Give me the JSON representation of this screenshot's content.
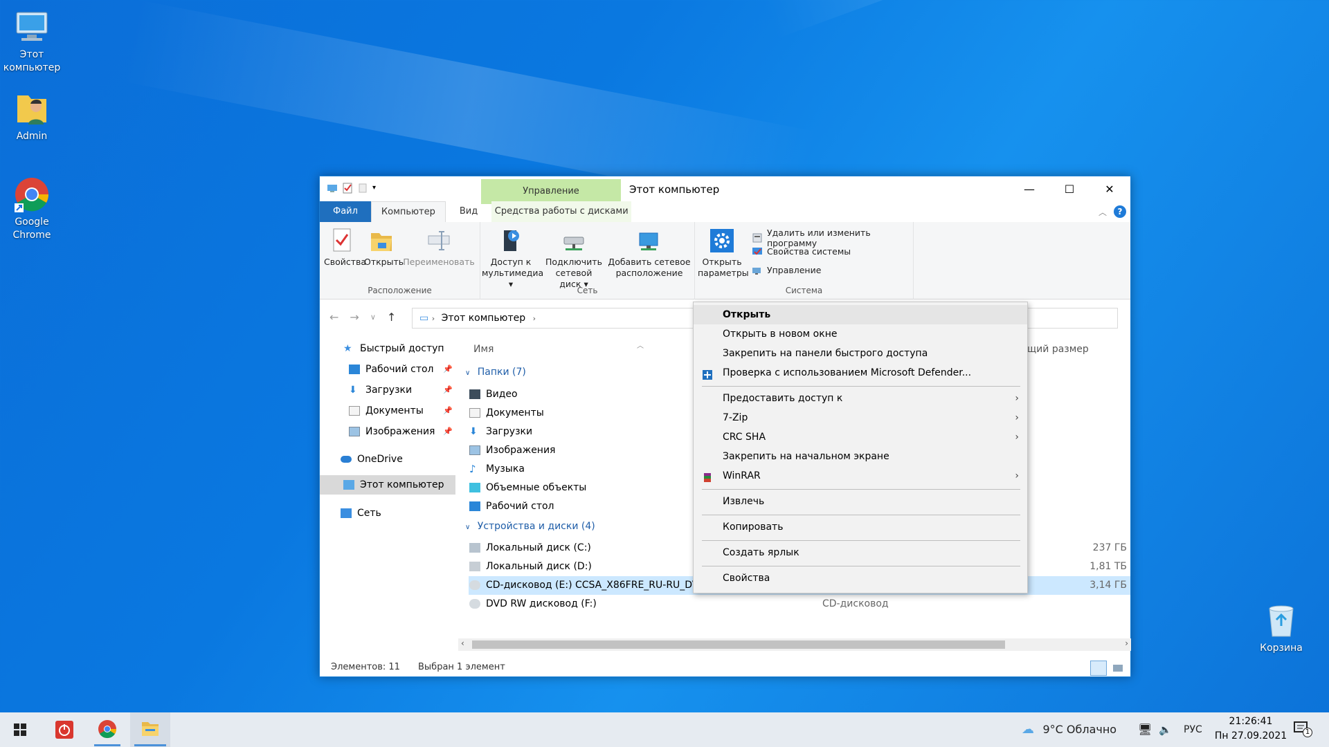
{
  "desktop": {
    "icons": [
      {
        "label": "Этот компьютер",
        "icon": "this-pc-icon"
      },
      {
        "label": "Admin",
        "icon": "user-folder-icon"
      },
      {
        "label": "Google Chrome",
        "icon": "chrome-icon"
      },
      {
        "label": "Корзина",
        "icon": "recycle-bin-icon"
      }
    ]
  },
  "window": {
    "title": "Этот компьютер",
    "context_tab_header": "Управление",
    "tabs": [
      "Файл",
      "Компьютер",
      "Вид",
      "Средства работы с дисками"
    ],
    "ribbon": {
      "groups": [
        "Расположение",
        "Сеть",
        "Система"
      ],
      "buttons": {
        "properties": "Свойства",
        "open": "Открыть",
        "rename": "Переименовать",
        "media_access": [
          "Доступ к",
          "мультимедиа"
        ],
        "map_drive": [
          "Подключить",
          "сетевой диск"
        ],
        "add_network": [
          "Добавить сетевое",
          "расположение"
        ],
        "open_settings": [
          "Открыть",
          "параметры"
        ],
        "uninstall": "Удалить или изменить программу",
        "system_props": "Свойства системы",
        "manage": "Управление"
      }
    },
    "address": {
      "location": "Этот компьютер"
    },
    "nav": {
      "quick_access": "Быстрый доступ",
      "items": [
        "Рабочий стол",
        "Загрузки",
        "Документы",
        "Изображения"
      ],
      "onedrive": "OneDrive",
      "this_pc": "Этот компьютер",
      "network": "Сеть"
    },
    "content": {
      "col_name": "Имя",
      "col_size": "щий размер",
      "folders_group": "Папки (7)",
      "folders": [
        "Видео",
        "Документы",
        "Загрузки",
        "Изображения",
        "Музыка",
        "Объемные объекты",
        "Рабочий стол"
      ],
      "devices_group": "Устройства и диски (4)",
      "devices": [
        {
          "name": "Локальный диск (C:)",
          "type": "",
          "size": "237 ГБ"
        },
        {
          "name": "Локальный диск (D:)",
          "type": "",
          "size": "1,81 ТБ"
        },
        {
          "name": "CD-дисковод (E:) CCSA_X86FRE_RU-RU_DV5",
          "type": "",
          "size": "3,14 ГБ"
        },
        {
          "name": "DVD RW дисковод (F:)",
          "type": "CD-дисковод",
          "size": ""
        }
      ]
    },
    "status": {
      "count": "Элементов: 11",
      "selected": "Выбран 1 элемент"
    }
  },
  "context_menu": {
    "items": [
      {
        "label": "Открыть",
        "bold": true
      },
      {
        "label": "Открыть в новом окне"
      },
      {
        "label": "Закрепить на панели быстрого доступа"
      },
      {
        "label": "Проверка с использованием Microsoft Defender..."
      },
      {
        "label": "Предоставить доступ к",
        "submenu": true
      },
      {
        "label": "7-Zip",
        "submenu": true
      },
      {
        "label": "CRC SHA",
        "submenu": true
      },
      {
        "label": "Закрепить на начальном экране"
      },
      {
        "label": "WinRAR",
        "submenu": true
      },
      {
        "label": "Извлечь"
      },
      {
        "label": "Копировать"
      },
      {
        "label": "Создать ярлык"
      },
      {
        "label": "Свойства"
      }
    ]
  },
  "taskbar": {
    "weather": "9°C  Облачно",
    "lang": "РУС",
    "time": "21:26:41",
    "date": "Пн 27.09.2021",
    "notif_count": "1"
  },
  "colors": {
    "accent": "#0078d7",
    "file_tab": "#1f6fbe",
    "context_tab": "#c5e8a6",
    "selection": "#cce8ff"
  }
}
